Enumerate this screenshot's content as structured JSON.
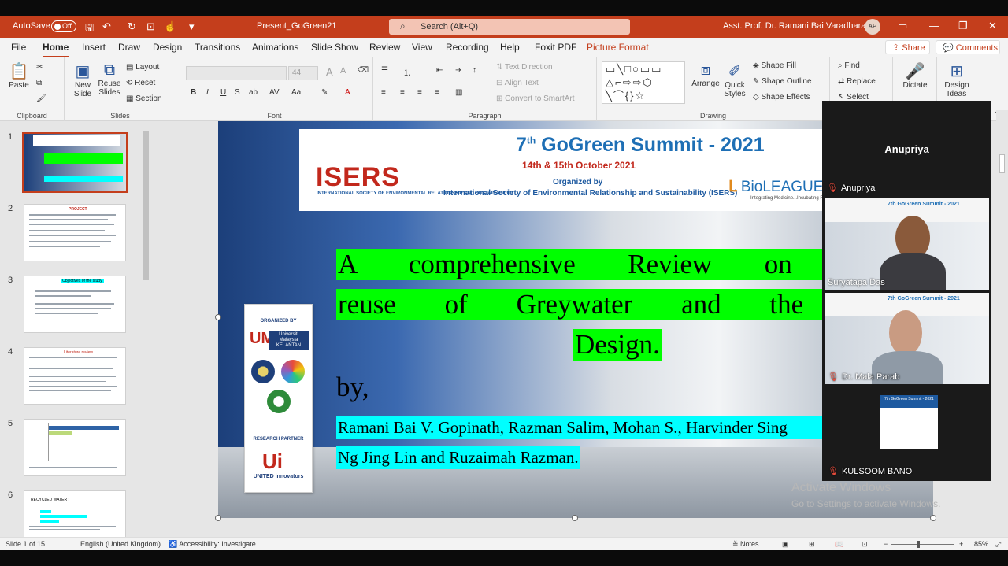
{
  "titlebar": {
    "autosave_label": "AutoSave",
    "autosave_state": "Off",
    "filename": "Present_GoGreen21",
    "search_placeholder": "Search (Alt+Q)",
    "user_name": "Asst. Prof. Dr. Ramani Bai Varadharajan",
    "user_initials": "AP"
  },
  "tabs": [
    "File",
    "Home",
    "Insert",
    "Draw",
    "Design",
    "Transitions",
    "Animations",
    "Slide Show",
    "Review",
    "View",
    "Recording",
    "Help",
    "Foxit PDF",
    "Picture Format"
  ],
  "active_tab": "Home",
  "share_label": "Share",
  "comments_label": "Comments",
  "ribbon": {
    "clipboard": {
      "label": "Clipboard",
      "paste": "Paste"
    },
    "slides": {
      "label": "Slides",
      "new_slide": "New Slide",
      "reuse_slides": "Reuse Slides",
      "layout": "Layout",
      "reset": "Reset",
      "section": "Section"
    },
    "font": {
      "label": "Font",
      "size": "44"
    },
    "paragraph": {
      "label": "Paragraph",
      "text_direction": "Text Direction",
      "align_text": "Align Text",
      "convert_smartart": "Convert to SmartArt"
    },
    "drawing": {
      "label": "Drawing",
      "arrange": "Arrange",
      "quick_styles": "Quick Styles",
      "shape_fill": "Shape Fill",
      "shape_outline": "Shape Outline",
      "shape_effects": "Shape Effects"
    },
    "editing": {
      "find": "Find",
      "replace": "Replace",
      "select": "Select"
    },
    "voice": {
      "dictate": "Dictate"
    },
    "designer": {
      "design_ideas": "Design Ideas"
    }
  },
  "thumbnails": [
    {
      "num": "1",
      "selected": true
    },
    {
      "num": "2",
      "title": "PROJECT"
    },
    {
      "num": "3",
      "title": "Objectives of the study"
    },
    {
      "num": "4",
      "title": "Literature review"
    },
    {
      "num": "5"
    },
    {
      "num": "6",
      "title": "RECYCLED WATER :"
    }
  ],
  "slide": {
    "banner_title": "7",
    "banner_title_sup": "th",
    "banner_title_rest": " GoGreen Summit - 2021",
    "banner_dates": "14th & 15th October 2021",
    "organized_by": "Organized by",
    "organizer": "International Society of Environmental Relationship and Sustainability (ISERS)",
    "isers_logo": "ISERS",
    "isers_sub": "INTERNATIONAL SOCIETY OF ENVIRONMENTAL RELATIONSHIP AND SUSTAINABILITY",
    "bioleague": "BioLEAGUE",
    "bioleague_tag": "Integrating Medicine...Incubating Research",
    "rollup_organized": "ORGANIZED BY",
    "rollup_um1": "UMK",
    "rollup_um2": "Universiti Malaysia KELANTAN",
    "rollup_research": "RESEARCH PARTNER",
    "rollup_ui": "Ui",
    "rollup_ui2": "UNITED innovators",
    "line1": "A comprehensive Review on recyclin",
    "line2": "reuse of Greywater and the Infrastr",
    "line3": "Design.",
    "by": "by,",
    "authors1": "Ramani Bai V. Gopinath, Razman Salim, Mohan S., Harvinder Sing",
    "authors2": "Ng Jing Lin and Ruzaimah Razman."
  },
  "video": {
    "speaker_big": "Anupriya",
    "speaker_label": "Anupriya",
    "p2": "Suryatapa Das",
    "p3": "Dr. Mala Parab",
    "p4": "KULSOOM BANO",
    "cam_title": "7th GoGreen Summit - 2021"
  },
  "watermark": {
    "line1": "Activate Windows",
    "line2": "Go to Settings to activate Windows."
  },
  "status": {
    "slide_info": "Slide 1 of 15",
    "language": "English (United Kingdom)",
    "accessibility": "Accessibility: Investigate",
    "notes": "Notes",
    "zoom": "85%"
  }
}
